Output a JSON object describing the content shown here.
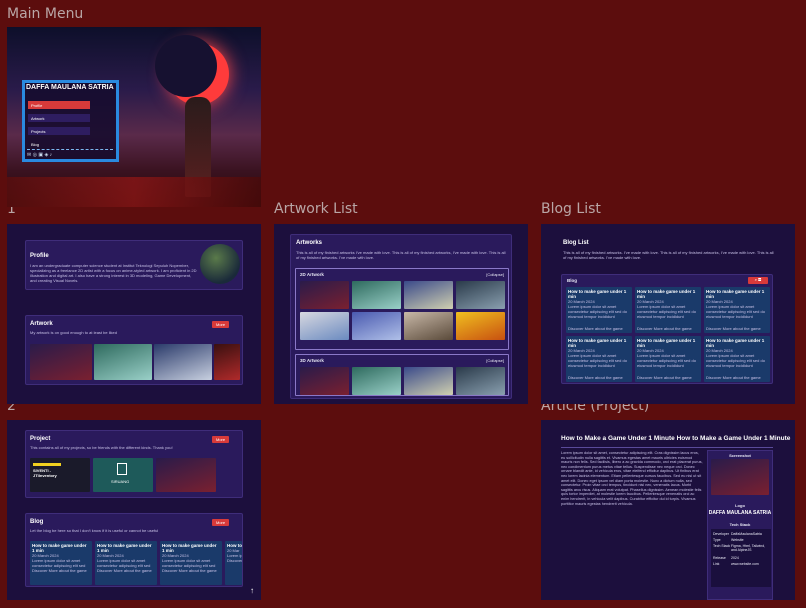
{
  "labels": {
    "main_menu": "Main Menu",
    "one": "1",
    "two": "2",
    "artwork_list": "Artwork List",
    "blog_list": "Blog List",
    "article": "Article (Project)"
  },
  "main_menu": {
    "name": "DAFFA MAULANA SATRIA",
    "items": [
      "Profile",
      "Artwork",
      "Projects",
      "Blog"
    ]
  },
  "screen1": {
    "profile_title": "Profile",
    "profile_text": "I am an undergraduate computer science student at Institut Teknologi Sepuluh Nopember, specializing as a freelance 2D artist with a focus on anime-styled artwork. I am proficient in 2D illustration and digital art. I also have a strong interest in 3D modeling, Game Development, and creating Visual Novels.",
    "artwork_title": "Artwork",
    "artwork_text": "My artwork is on good enough to at least be liked",
    "more": "More"
  },
  "screen2": {
    "project_title": "Project",
    "project_text": "This contains all of my projects, so be friends with the different kinds. Thank you!",
    "proj1_label": "SIVENTI - JTIInventory",
    "proj2_label": "SIRUANG",
    "blog_title": "Blog",
    "blog_text": "Let the blog be here so that I don't know if it is useful or cannot be useful",
    "more": "More",
    "blog_cards": [
      {
        "title": "How to make game under 1 min",
        "date": "20 March 2024",
        "text": "Lorem ipsum dolor sit amet consectetur adipiscing elit sed do eiusmod tempor",
        "footer": "Discover More about the game"
      },
      {
        "title": "How to make game under 1 min",
        "date": "20 March 2024",
        "text": "Lorem ipsum dolor sit amet consectetur adipiscing elit sed do eiusmod tempor",
        "footer": "Discover More about the game"
      },
      {
        "title": "How to make game under 1 min",
        "date": "20 March 2024",
        "text": "Lorem ipsum dolor sit amet consectetur adipiscing elit sed do eiusmod tempor",
        "footer": "Discover More about the game"
      },
      {
        "title": "How to m",
        "date": "20 Mar",
        "text": "Lorem ipsum",
        "footer": "Discover"
      }
    ]
  },
  "artwork_list": {
    "title": "Artworks",
    "text": "This is all of my finished artworks I've made with love. This is all of my finished artworks, I've made with love. This is all of my finished artworks. I've made with love.",
    "section_2d": "2D Artwork",
    "section_3d": "3D Artwork",
    "collapse": "[Collapse]"
  },
  "blog_list": {
    "title": "Blog List",
    "text": "This is all of my finished artworks. I've made with love. This is all of my finished artworks, I've made with love. This is all of my finished artworks. I've made with love.",
    "section": "Blog",
    "cards": [
      {
        "title": "How to make game under 1 min",
        "date": "20 March 2024"
      },
      {
        "title": "How to make game under 1 min",
        "date": "20 March 2024"
      },
      {
        "title": "How to make game under 1 min",
        "date": "20 March 2024"
      },
      {
        "title": "How to make game under 1 min",
        "date": "20 March 2024"
      },
      {
        "title": "How to make game under 1 min",
        "date": "20 March 2024"
      },
      {
        "title": "How to make game under 1 min",
        "date": "20 March 2024"
      }
    ],
    "card_text": "Lorem ipsum dolor sit amet consectetur adipiscing elit sed do eiusmod tempor incididunt",
    "card_footer": "Discover More about the game"
  },
  "article": {
    "title": "How to Make a Game Under 1 Minute How to Make a Game Under 1 Minute",
    "body": "Lorem ipsum dolor sit amet, consectetur adipiscing elit. Cras dignissim lacus eros, eu sollicitudin nulla sagittis et. Vivamus egestas amet mauris ultricies euismod mauris non felis. Sed facilisis, libero a ac gravida commodo, orci erat placerat purus, nec condimentum purus metus vitae tellus. Suspendisse nec neque orci. Donec ornare blandit ante, id vehicula eros, vitae eleifend efficitur dapibus. Ut finibus erat nec lorem lacinia elementum. Etiam pellentesque cursus faucibus. Sed eu nisl ut sit amet elit. Donec eget ipsum vel diam porta molestie. Nunc a dictum nulla, sed consectetur. Proin vitae orci tempus, tincidunt nisl nec, venenatis lacus. Morbi sagittis arcu risus. Aliquam erat volutpat. Phasellus dignissim. Aenean molestie felis quis tortor imperdiet, at molestie lorem faucibus. Pellentesque venenatis orci ac enim hendrerit, in vehicula velit dapibus. Curabitur efficitur dui id turpis. Vivamus porttitor mauris egestas hendrerit vehicula.",
    "screenshot_label": "Screenshot",
    "logo_label": "Logo",
    "logo_name": "DAFFA MAULANA SATRIA",
    "tech_label": "Tech Stack",
    "tech_rows": [
      [
        "Developer",
        "DaffaMaulanaSatria"
      ],
      [
        "Type",
        "Website"
      ],
      [
        "Tech Stack",
        "Figma, Html, Tailwind, and AlpineJS"
      ],
      [
        "Release",
        "2024"
      ],
      [
        "Link",
        "www.website.com"
      ]
    ]
  }
}
